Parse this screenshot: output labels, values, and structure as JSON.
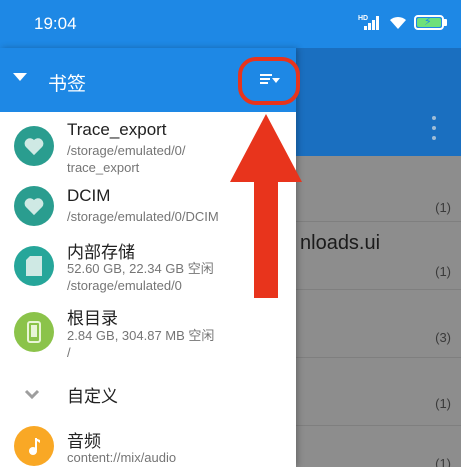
{
  "status_bar": {
    "time": "19:04",
    "signal_label": "HD",
    "icons": [
      "signal-icon",
      "wifi-icon",
      "battery-charging-icon"
    ]
  },
  "background_app": {
    "visible_text": "nloads.ui",
    "counts": [
      "(1)",
      "(1)",
      "(3)",
      "(1)",
      "(1)"
    ]
  },
  "drawer": {
    "title": "书签",
    "sort_icon": "sort-icon",
    "bookmarks": [
      {
        "icon": "heart-icon",
        "title": "Trace_export",
        "lines": [
          "/storage/emulated/0/",
          "trace_export"
        ],
        "color": "#2a9d8f"
      },
      {
        "icon": "heart-icon",
        "title": "DCIM",
        "lines": [
          "/storage/emulated/0/DCIM"
        ],
        "color": "#2a9d8f"
      },
      {
        "icon": "sd-card-icon",
        "title": "内部存储",
        "lines": [
          "52.60 GB, 22.34 GB 空闲",
          "/storage/emulated/0"
        ],
        "color": "#26a69a"
      },
      {
        "icon": "phone-icon",
        "title": "根目录",
        "lines": [
          "2.84 GB, 304.87 MB 空闲",
          "/"
        ],
        "color": "#8bc34a"
      }
    ],
    "section": {
      "label": "自定义"
    },
    "custom_items": [
      {
        "icon": "music-note-icon",
        "title": "音频",
        "lines": [
          "content://mix/audio"
        ],
        "color": "#f9a825"
      }
    ]
  },
  "colors": {
    "primary": "#1e88e5",
    "annotation": "#e8341c"
  }
}
